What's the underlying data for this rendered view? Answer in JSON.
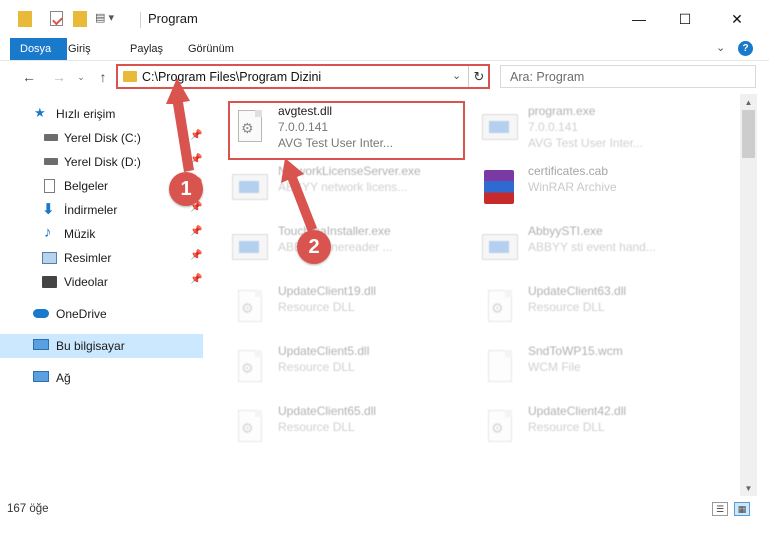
{
  "window": {
    "title": "Program",
    "minimize": "—",
    "maximize": "☐",
    "close": "✕"
  },
  "ribbon": {
    "tabs": [
      "Dosya",
      "Giriş",
      "Paylaş",
      "Görünüm"
    ],
    "help": "?"
  },
  "address": {
    "path": "C:\\Program Files\\Program Dizini",
    "search_placeholder": "Ara: Program"
  },
  "nav": {
    "items": [
      {
        "label": "Hızlı erişim",
        "icon": "star-icon",
        "pinned": false
      },
      {
        "label": "Yerel Disk (C:)",
        "icon": "drive-icon",
        "pinned": true
      },
      {
        "label": "Yerel Disk (D:)",
        "icon": "drive-icon",
        "pinned": true
      },
      {
        "label": "Belgeler",
        "icon": "documents-icon",
        "pinned": true
      },
      {
        "label": "İndirmeler",
        "icon": "download-icon",
        "pinned": true
      },
      {
        "label": "Müzik",
        "icon": "music-icon",
        "pinned": true
      },
      {
        "label": "Resimler",
        "icon": "pictures-icon",
        "pinned": true
      },
      {
        "label": "Videolar",
        "icon": "video-icon",
        "pinned": true
      },
      {
        "label": "OneDrive",
        "icon": "cloud-icon",
        "pinned": false
      },
      {
        "label": "Bu bilgisayar",
        "icon": "computer-icon",
        "pinned": false
      },
      {
        "label": "Ağ",
        "icon": "network-icon",
        "pinned": false
      }
    ]
  },
  "files": [
    {
      "name": "avgtest.dll",
      "version": "7.0.0.141",
      "desc": "AVG Test User Inter...",
      "type": "dll"
    },
    {
      "name": "program.exe",
      "version": "7.0.0.141",
      "desc": "AVG Test User Inter...",
      "type": "exe"
    },
    {
      "name": "NetworkLicenseServer.exe",
      "version": "",
      "desc": "ABBYY network licens...",
      "type": "exe"
    },
    {
      "name": "certificates.cab",
      "version": "",
      "desc": "WinRAR Archive",
      "type": "cab"
    },
    {
      "name": "TouchmaInstaller.exe",
      "version": "",
      "desc": "ABBYY Finereader ...",
      "type": "exe"
    },
    {
      "name": "AbbyySTI.exe",
      "version": "",
      "desc": "ABBYY sti event hand...",
      "type": "exe"
    },
    {
      "name": "UpdateClient19.dll",
      "version": "",
      "desc": "Resource DLL",
      "type": "dll"
    },
    {
      "name": "UpdateClient63.dll",
      "version": "",
      "desc": "Resource DLL",
      "type": "dll"
    },
    {
      "name": "UpdateClient5.dll",
      "version": "",
      "desc": "Resource DLL",
      "type": "dll"
    },
    {
      "name": "SndToWP15.wcm",
      "version": "",
      "desc": "WCM File",
      "type": "dll"
    },
    {
      "name": "UpdateClient65.dll",
      "version": "",
      "desc": "Resource DLL",
      "type": "dll"
    },
    {
      "name": "UpdateClient42.dll",
      "version": "",
      "desc": "Resource DLL",
      "type": "dll"
    }
  ],
  "annotations": {
    "step1": "1",
    "step2": "2",
    "accent": "#d9534f"
  },
  "status": {
    "count": "167 öğe"
  }
}
